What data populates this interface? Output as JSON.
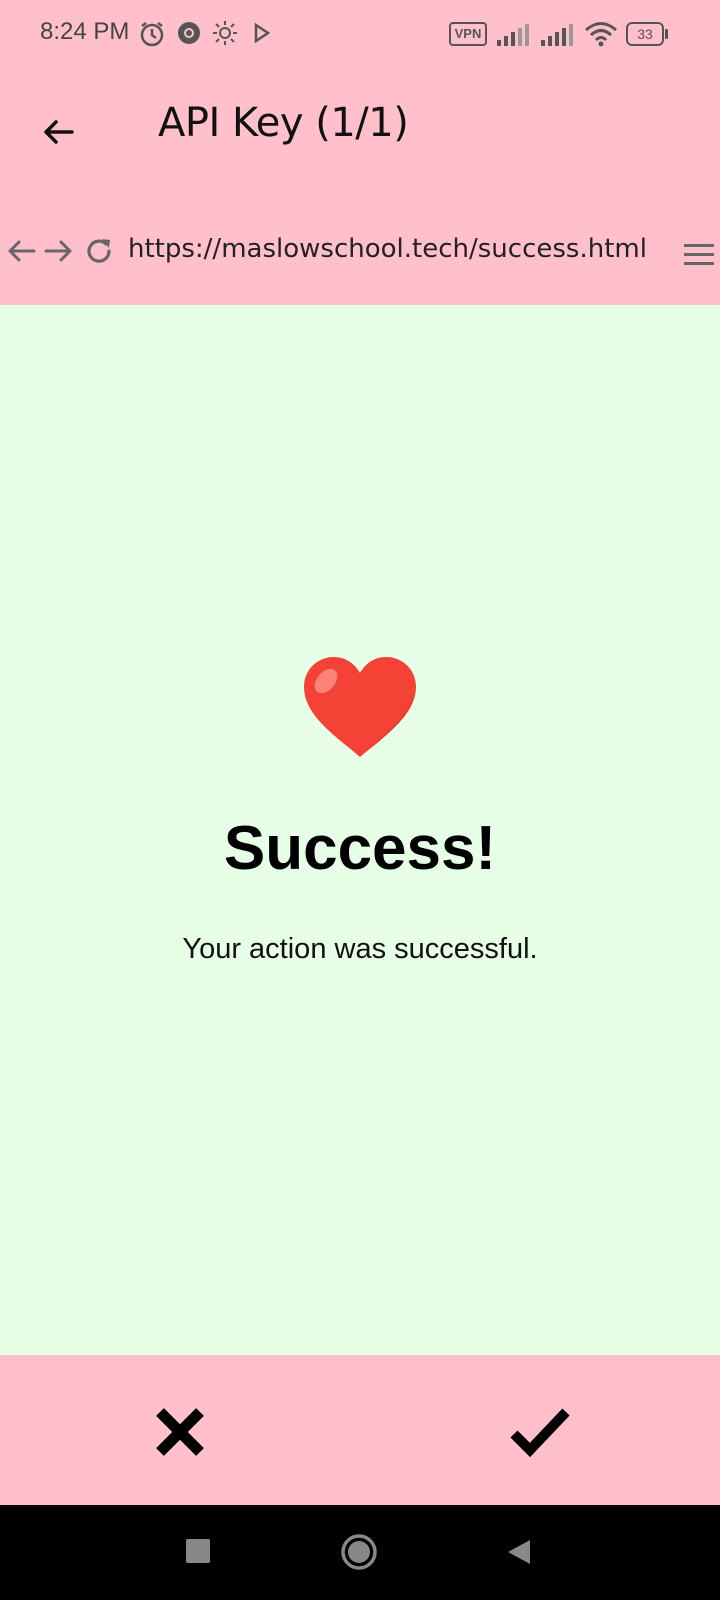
{
  "status_bar": {
    "time": "8:24 PM",
    "icons": [
      "alarm-icon",
      "chrome-icon",
      "brightness-icon",
      "play-icon",
      "vpn-icon",
      "signal-icon",
      "signal-icon",
      "wifi-icon",
      "battery-icon"
    ],
    "vpn_label": "VPN",
    "battery_level": "33"
  },
  "app_bar": {
    "title": "API Key (1/1)",
    "back_icon": "arrow-left-icon"
  },
  "browser_bar": {
    "url": "https://maslowschool.tech/success.html",
    "icons": [
      "arrow-left-icon",
      "arrow-right-icon",
      "refresh-icon",
      "menu-icon"
    ]
  },
  "page": {
    "emoji": "heart-icon",
    "heading": "Success!",
    "message": "Your action was successful.",
    "background": "#e6ffe6"
  },
  "actions": {
    "reject_icon": "close-icon",
    "accept_icon": "check-icon"
  },
  "system_nav": {
    "icons": [
      "recent-apps-icon",
      "home-icon",
      "back-icon"
    ]
  },
  "colors": {
    "chrome_bg": "#ffc0cb",
    "content_bg": "#e6ffe6",
    "heart": "#f44336"
  }
}
